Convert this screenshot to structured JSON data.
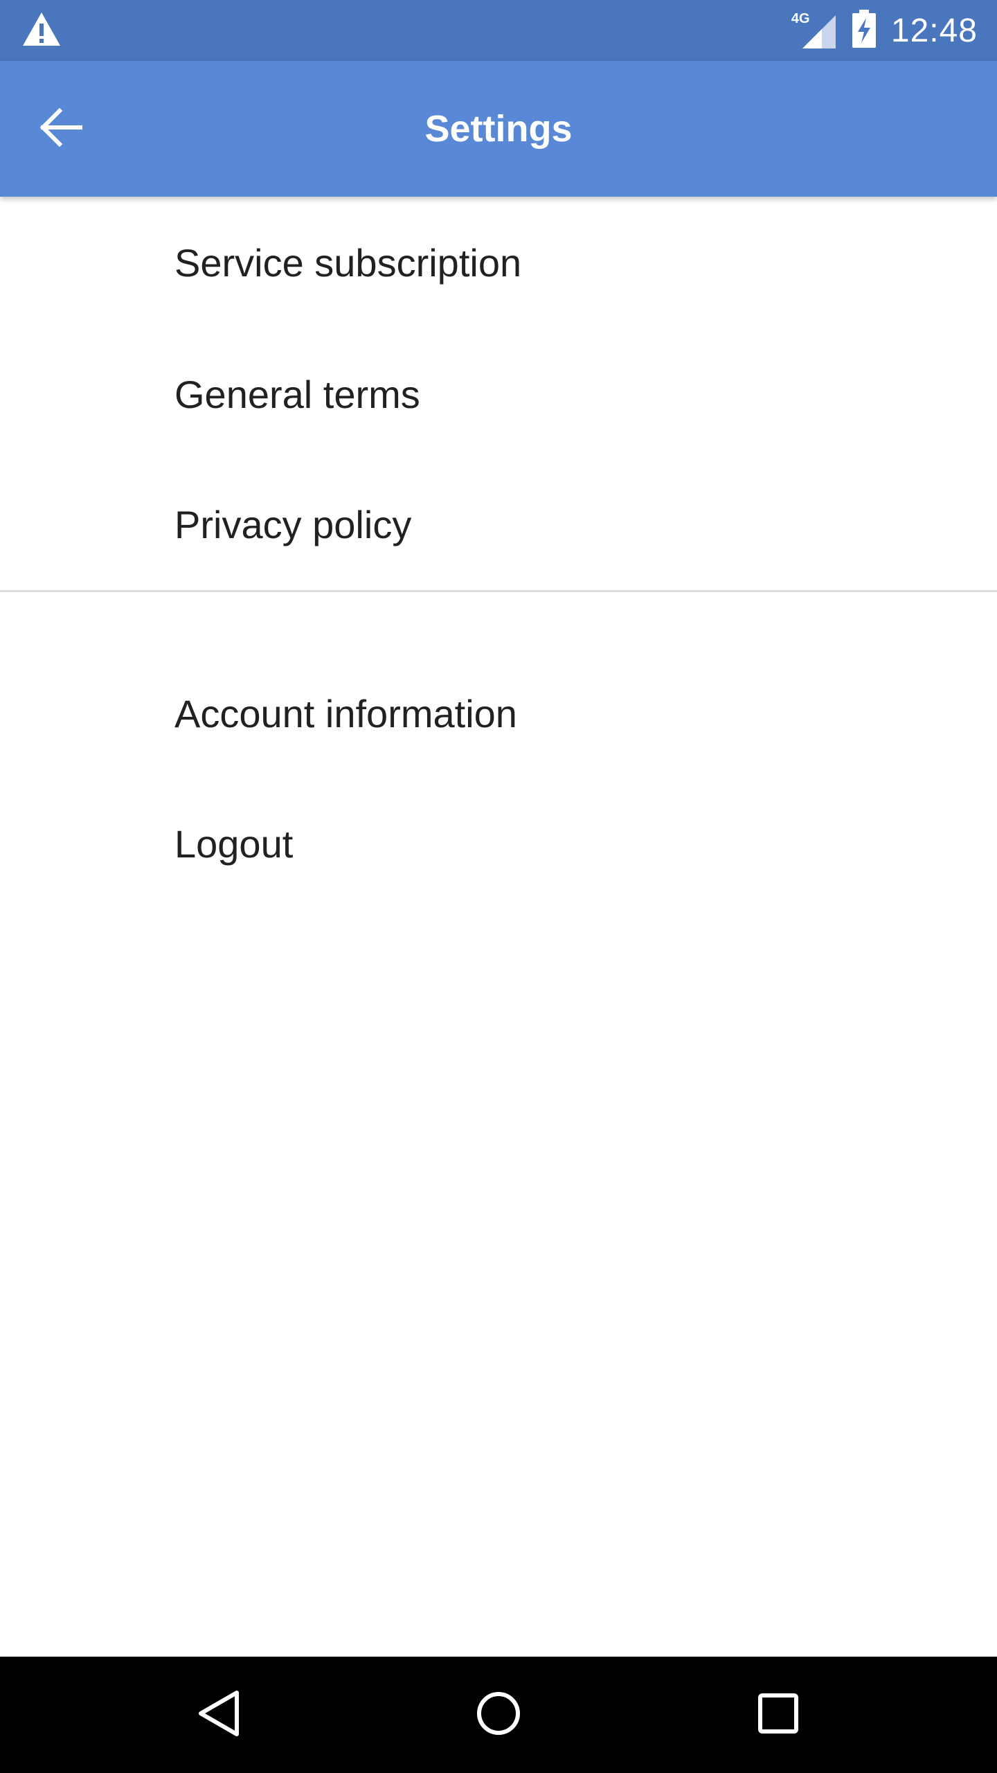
{
  "status_bar": {
    "time": "12:48",
    "network_label": "4G",
    "icons": [
      "warning-icon",
      "signal-icon",
      "battery-charging-icon"
    ]
  },
  "app_bar": {
    "title": "Settings",
    "back_icon": "arrow-back-icon"
  },
  "menu": {
    "group_one": [
      {
        "label": "Service subscription"
      },
      {
        "label": "General terms"
      },
      {
        "label": "Privacy policy"
      }
    ],
    "group_two": [
      {
        "label": "Account information"
      },
      {
        "label": "Logout"
      }
    ]
  },
  "nav_bar": {
    "icons": [
      "nav-back-icon",
      "nav-home-icon",
      "nav-recents-icon"
    ]
  },
  "colors": {
    "status_bar": "#4a76bd",
    "app_bar": "#5888d6",
    "nav_bar": "#000000",
    "text": "#212121"
  }
}
